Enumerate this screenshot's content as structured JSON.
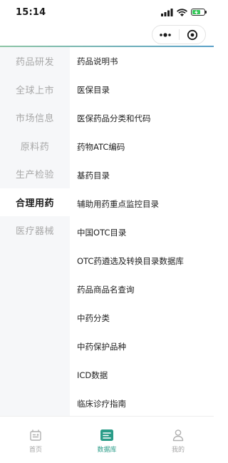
{
  "status_bar": {
    "time": "15:14"
  },
  "colors": {
    "accent": "#2a9c88",
    "battery": "#35c759",
    "sidebar_bg": "#f6f7f9",
    "inactive_text": "#a8a8a8"
  },
  "sidebar": {
    "items": [
      {
        "label": "药品研发",
        "active": false
      },
      {
        "label": "全球上市",
        "active": false
      },
      {
        "label": "市场信息",
        "active": false
      },
      {
        "label": "原料药",
        "active": false
      },
      {
        "label": "生产检验",
        "active": false
      },
      {
        "label": "合理用药",
        "active": true
      },
      {
        "label": "医疗器械",
        "active": false
      }
    ]
  },
  "list": {
    "items": [
      "药品说明书",
      "医保目录",
      "医保药品分类和代码",
      "药物ATC编码",
      "基药目录",
      "辅助用药重点监控目录",
      "中国OTC目录",
      "OTC药遴选及转换目录数据库",
      "药品商品名查询",
      "中药分类",
      "中药保护品种",
      "ICD数据",
      "临床诊疗指南"
    ]
  },
  "tab_bar": {
    "tabs": [
      {
        "label": "首页",
        "icon": "home-icon",
        "active": false
      },
      {
        "label": "数据库",
        "icon": "database-icon",
        "active": true
      },
      {
        "label": "我的",
        "icon": "profile-icon",
        "active": false
      }
    ]
  }
}
